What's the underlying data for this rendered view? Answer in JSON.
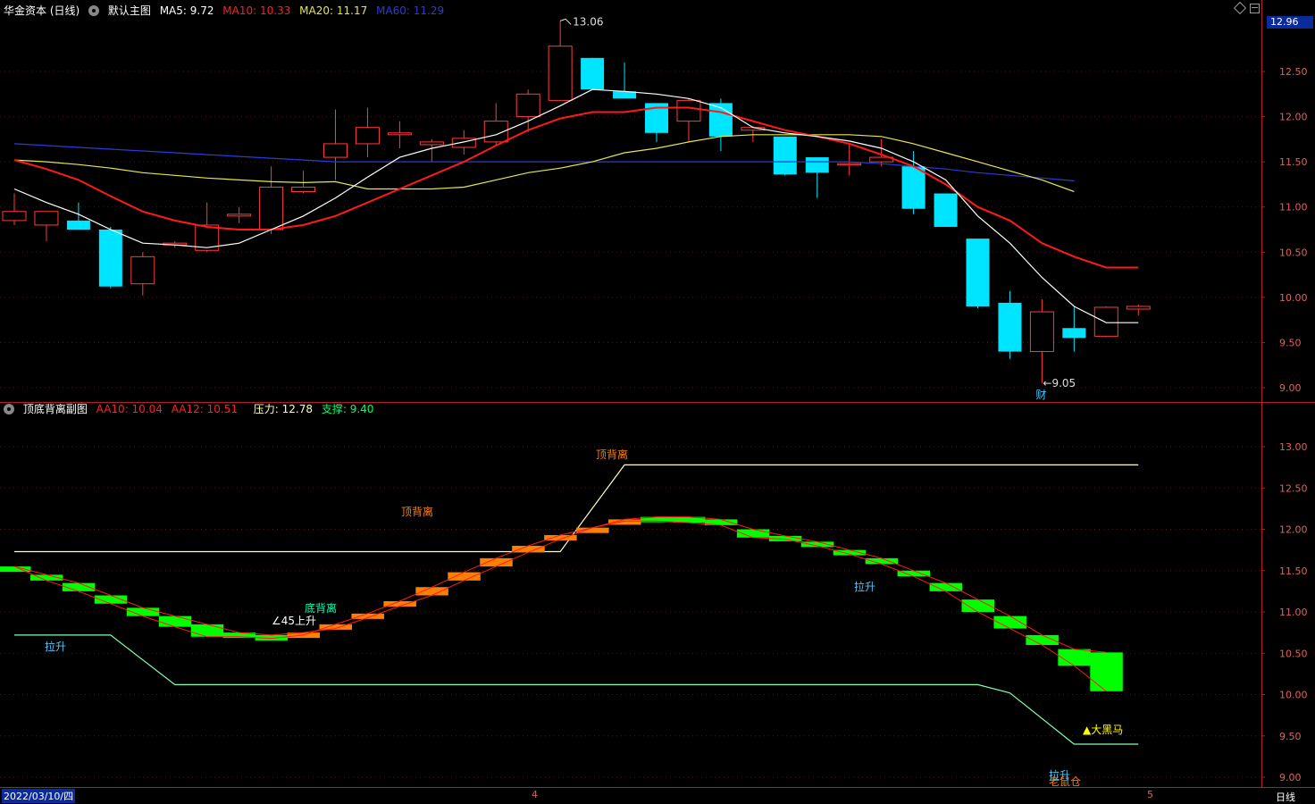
{
  "main_header": {
    "title": "华金资本 (日线)",
    "template": "默认主图",
    "ma5": "MA5: 9.72",
    "ma10": "MA10: 10.33",
    "ma20": "MA20: 11.17",
    "ma60": "MA60: 11.29"
  },
  "sub_header": {
    "title": "顶底背离副图",
    "aa10": "AA10: 10.04",
    "aa12": "AA12: 10.51",
    "pressure": "压力: 12.78",
    "support": "支撑: 9.40"
  },
  "current_price": "12.96",
  "bottom_bar": {
    "date": "2022/03/10/四",
    "month_4": "4",
    "month_5": "5",
    "period": "日线"
  },
  "colors": {
    "up": "#ff3b3b",
    "down": "#00e5ff",
    "ma5": "#ffffff",
    "ma10": "#ff1a1a",
    "ma20": "#e6e64d",
    "ma60": "#2b3bd9",
    "axis": "#b0201c",
    "orange": "#ff7f00",
    "green": "#00ff00",
    "pressure": "#ffffc0",
    "support": "#7fffb0"
  },
  "chart_data": [
    {
      "type": "candlestick",
      "ylim": [
        8.9,
        13.4
      ],
      "yticks": [
        "12.50",
        "12.00",
        "11.50",
        "11.00",
        "10.50",
        "10.00",
        "9.50",
        "9.00"
      ],
      "candles": [
        {
          "o": 10.85,
          "h": 11.15,
          "l": 10.8,
          "c": 10.95
        },
        {
          "o": 10.8,
          "h": 10.95,
          "l": 10.62,
          "c": 10.95
        },
        {
          "o": 10.85,
          "h": 11.05,
          "l": 10.75,
          "c": 10.75
        },
        {
          "o": 10.75,
          "h": 10.78,
          "l": 10.1,
          "c": 10.12
        },
        {
          "o": 10.15,
          "h": 10.5,
          "l": 10.02,
          "c": 10.45
        },
        {
          "o": 10.58,
          "h": 10.62,
          "l": 10.55,
          "c": 10.6
        },
        {
          "o": 10.52,
          "h": 11.05,
          "l": 10.5,
          "c": 10.8
        },
        {
          "o": 10.9,
          "h": 11.0,
          "l": 10.82,
          "c": 10.92
        },
        {
          "o": 10.75,
          "h": 11.45,
          "l": 10.7,
          "c": 11.22
        },
        {
          "o": 11.17,
          "h": 11.4,
          "l": 11.15,
          "c": 11.22
        },
        {
          "o": 11.55,
          "h": 12.08,
          "l": 11.3,
          "c": 11.7
        },
        {
          "o": 11.7,
          "h": 12.1,
          "l": 11.55,
          "c": 11.88
        },
        {
          "o": 11.8,
          "h": 11.95,
          "l": 11.65,
          "c": 11.82
        },
        {
          "o": 11.69,
          "h": 11.75,
          "l": 11.5,
          "c": 11.72
        },
        {
          "o": 11.66,
          "h": 11.85,
          "l": 11.58,
          "c": 11.76
        },
        {
          "o": 11.72,
          "h": 12.15,
          "l": 11.68,
          "c": 11.95
        },
        {
          "o": 12.0,
          "h": 12.3,
          "l": 11.83,
          "c": 12.25
        },
        {
          "o": 12.18,
          "h": 13.06,
          "l": 12.18,
          "c": 12.78
        },
        {
          "o": 12.65,
          "h": 12.65,
          "l": 12.3,
          "c": 12.3
        },
        {
          "o": 12.28,
          "h": 12.6,
          "l": 12.2,
          "c": 12.2
        },
        {
          "o": 12.15,
          "h": 12.15,
          "l": 11.72,
          "c": 11.82
        },
        {
          "o": 11.95,
          "h": 12.2,
          "l": 11.72,
          "c": 12.18
        },
        {
          "o": 12.15,
          "h": 12.2,
          "l": 11.62,
          "c": 11.78
        },
        {
          "o": 11.85,
          "h": 11.9,
          "l": 11.72,
          "c": 11.88
        },
        {
          "o": 11.78,
          "h": 11.78,
          "l": 11.35,
          "c": 11.36
        },
        {
          "o": 11.55,
          "h": 11.55,
          "l": 11.1,
          "c": 11.38
        },
        {
          "o": 11.48,
          "h": 11.7,
          "l": 11.35,
          "c": 11.48
        },
        {
          "o": 11.5,
          "h": 11.75,
          "l": 11.45,
          "c": 11.55
        },
        {
          "o": 11.45,
          "h": 11.62,
          "l": 10.92,
          "c": 10.98
        },
        {
          "o": 11.15,
          "h": 11.15,
          "l": 10.78,
          "c": 10.78
        },
        {
          "o": 10.65,
          "h": 10.65,
          "l": 9.88,
          "c": 9.9
        },
        {
          "o": 9.94,
          "h": 10.07,
          "l": 9.32,
          "c": 9.4
        },
        {
          "o": 9.4,
          "h": 9.98,
          "l": 9.05,
          "c": 9.84
        },
        {
          "o": 9.66,
          "h": 9.9,
          "l": 9.4,
          "c": 9.55
        },
        {
          "o": 9.57,
          "h": 9.9,
          "l": 9.57,
          "c": 9.89
        },
        {
          "o": 9.87,
          "h": 9.92,
          "l": 9.8,
          "c": 9.9
        }
      ],
      "ma5": [
        11.2,
        11.05,
        10.92,
        10.75,
        10.6,
        10.58,
        10.55,
        10.6,
        10.75,
        10.9,
        11.1,
        11.33,
        11.55,
        11.65,
        11.72,
        11.8,
        11.95,
        12.12,
        12.3,
        12.28,
        12.25,
        12.2,
        12.1,
        11.88,
        11.82,
        11.78,
        11.73,
        11.65,
        11.5,
        11.3,
        10.9,
        10.6,
        10.22,
        9.9,
        9.72,
        9.72
      ],
      "ma10": [
        11.52,
        11.42,
        11.3,
        11.12,
        10.95,
        10.85,
        10.78,
        10.75,
        10.75,
        10.8,
        10.9,
        11.05,
        11.2,
        11.35,
        11.5,
        11.68,
        11.85,
        11.98,
        12.05,
        12.05,
        12.1,
        12.1,
        12.05,
        11.95,
        11.85,
        11.78,
        11.7,
        11.58,
        11.45,
        11.25,
        11.0,
        10.85,
        10.6,
        10.45,
        10.33,
        10.33
      ],
      "ma20": [
        11.52,
        11.5,
        11.47,
        11.43,
        11.38,
        11.35,
        11.32,
        11.3,
        11.28,
        11.27,
        11.28,
        11.2,
        11.2,
        11.2,
        11.22,
        11.3,
        11.38,
        11.43,
        11.5,
        11.6,
        11.65,
        11.72,
        11.78,
        11.8,
        11.8,
        11.8,
        11.8,
        11.78,
        11.7,
        11.6,
        11.5,
        11.4,
        11.3,
        11.17
      ],
      "ma60": [
        11.7,
        11.68,
        11.66,
        11.64,
        11.62,
        11.6,
        11.58,
        11.56,
        11.54,
        11.52,
        11.5,
        11.5,
        11.5,
        11.5,
        11.5,
        11.5,
        11.5,
        11.5,
        11.5,
        11.5,
        11.5,
        11.5,
        11.5,
        11.5,
        11.5,
        11.5,
        11.5,
        11.48,
        11.45,
        11.42,
        11.38,
        11.35,
        11.32,
        11.29
      ],
      "annotations": {
        "high_label": "13.06",
        "low_label": "9.05",
        "finance_mark": "财"
      }
    },
    {
      "type": "band",
      "ylim": [
        8.9,
        13.2
      ],
      "yticks": [
        "13.00",
        "12.50",
        "12.00",
        "11.50",
        "11.00",
        "10.50",
        "10.00",
        "9.50",
        "9.00"
      ],
      "aa10": [
        11.55,
        11.38,
        11.25,
        11.1,
        10.95,
        10.82,
        10.7,
        10.7,
        10.68,
        10.72,
        10.85,
        10.98,
        11.13,
        11.3,
        11.48,
        11.65,
        11.8,
        11.93,
        12.02,
        12.1,
        12.1,
        12.08,
        12.05,
        11.9,
        11.88,
        11.8,
        11.7,
        11.58,
        11.43,
        11.25,
        11.0,
        10.8,
        10.6,
        10.35,
        10.04
      ],
      "aa12": [
        11.55,
        11.45,
        11.35,
        11.2,
        11.05,
        10.95,
        10.85,
        10.75,
        10.72,
        10.75,
        10.8,
        10.93,
        11.07,
        11.2,
        11.38,
        11.55,
        11.72,
        11.88,
        12.02,
        12.12,
        12.15,
        12.15,
        12.12,
        12.0,
        11.92,
        11.85,
        11.75,
        11.65,
        11.5,
        11.35,
        11.15,
        10.95,
        10.72,
        10.55,
        10.51
      ],
      "pressure": {
        "from": 11.73,
        "step_to": 12.78
      },
      "support": {
        "from": 10.72,
        "mid": 10.12,
        "to": 9.4
      },
      "labels": [
        "顶背离",
        "顶背离",
        "底背离",
        "45上升",
        "拉升",
        "拉升",
        "▲大黑马",
        "拉升",
        "老鼠仓"
      ]
    }
  ]
}
